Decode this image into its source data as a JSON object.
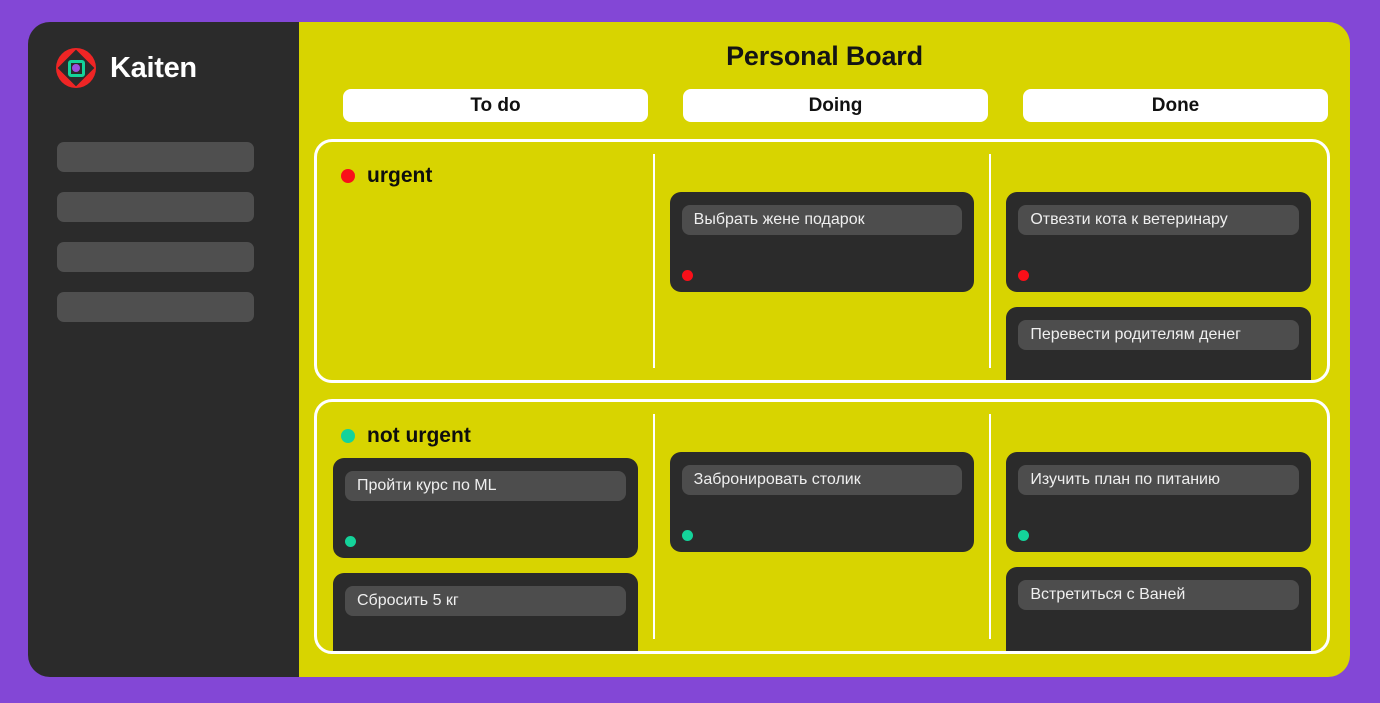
{
  "theme": {
    "page_background": "#8347d6",
    "board_background": "#d8d400",
    "sidebar_background": "#2b2b2b",
    "card_background": "#2b2b2b",
    "card_title_background": "#4d4d4d",
    "tab_background": "#ffffff",
    "lane_border": "#ffffff",
    "urgent_color": "#fa0f19",
    "not_urgent_color": "#14d39a",
    "logo_red": "#ef2525",
    "logo_teal": "#14d39a",
    "logo_purple": "#9b4fe0"
  },
  "sidebar": {
    "brand_name": "Kaiten",
    "logo_icon": "kaiten-logo-icon",
    "nav_placeholders": [
      {
        "label": ""
      },
      {
        "label": ""
      },
      {
        "label": ""
      },
      {
        "label": ""
      }
    ]
  },
  "board": {
    "title": "Personal Board",
    "columns": [
      {
        "id": "todo",
        "label": "To do"
      },
      {
        "id": "doing",
        "label": "Doing"
      },
      {
        "id": "done",
        "label": "Done"
      }
    ],
    "lanes": [
      {
        "id": "urgent",
        "title": "urgent",
        "dot_color": "#fa0f19",
        "columns": [
          {
            "id": "todo",
            "cards": []
          },
          {
            "id": "doing",
            "cards": [
              {
                "title": "Выбрать жене подарок",
                "dot_color": "#fa0f19",
                "has_dot": true
              }
            ]
          },
          {
            "id": "done",
            "cards": [
              {
                "title": "Отвезти кота к ветеринару",
                "dot_color": "#fa0f19",
                "has_dot": true
              },
              {
                "title": "Перевести родителям денег",
                "dot_color": "#fa0f19",
                "has_dot": false
              }
            ]
          }
        ]
      },
      {
        "id": "not-urgent",
        "title": "not urgent",
        "dot_color": "#14d39a",
        "columns": [
          {
            "id": "todo",
            "cards": [
              {
                "title": "Пройти курс по ML",
                "dot_color": "#14d39a",
                "has_dot": true
              },
              {
                "title": "Сбросить 5 кг",
                "dot_color": "#14d39a",
                "has_dot": false
              }
            ]
          },
          {
            "id": "doing",
            "cards": [
              {
                "title": "Забронировать столик",
                "dot_color": "#14d39a",
                "has_dot": true
              }
            ]
          },
          {
            "id": "done",
            "cards": [
              {
                "title": "Изучить план по питанию",
                "dot_color": "#14d39a",
                "has_dot": true
              },
              {
                "title": "Встретиться с Ваней",
                "dot_color": "#14d39a",
                "has_dot": false
              }
            ]
          }
        ]
      }
    ]
  }
}
